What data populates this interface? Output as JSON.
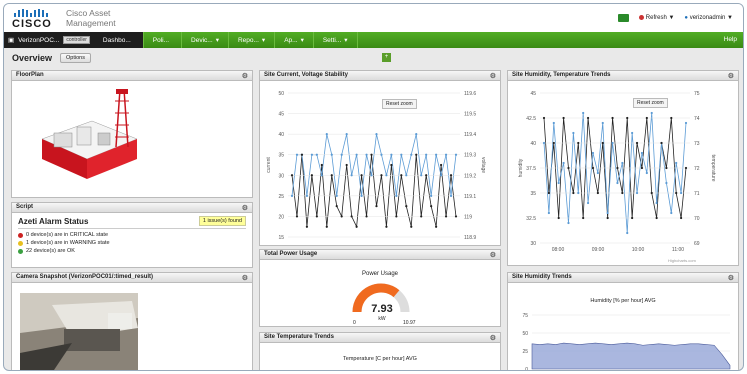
{
  "brand": {
    "name": "CISCO",
    "product_line1": "Cisco Asset",
    "product_line2": "Management"
  },
  "header": {
    "refresh": "Refresh ▼",
    "user": "verizonadmin ▼"
  },
  "nav": {
    "site": "VerizonPOC...",
    "controller": "controller",
    "items": [
      {
        "label": "Dashbo...",
        "arrow": ""
      },
      {
        "label": "Poli...",
        "arrow": ""
      },
      {
        "label": "Devic...",
        "arrow": "▾"
      },
      {
        "label": "Repo...",
        "arrow": "▾"
      },
      {
        "label": "Ap...",
        "arrow": "▾"
      },
      {
        "label": "Setti...",
        "arrow": "▾"
      }
    ],
    "help": "Help"
  },
  "overview": {
    "title": "Overview",
    "options": "Options",
    "add": "+"
  },
  "panels": {
    "floorplan": "FloorPlan",
    "script": "Script",
    "camera": "Camera Snapshot (VerizonPOC01/:timed_result)",
    "current": "Site Current, Voltage Stability",
    "power": "Total Power Usage",
    "temperature": "Site Temperature Trends",
    "humtemp": "Site Humidity, Temperature Trends",
    "humidity": "Site Humidity Trends"
  },
  "alarm": {
    "title": "Azeti Alarm Status",
    "issues": "1 issue(s) found",
    "lines": [
      {
        "color": "#cc2222",
        "text": "0 device(s) are in CRITICAL state"
      },
      {
        "color": "#e8c020",
        "text": "1 device(s) are in WARNING state"
      },
      {
        "color": "#3aa040",
        "text": "22 device(s) are OK"
      }
    ]
  },
  "power_gauge": {
    "title": "Power Usage",
    "value": "7.93",
    "unit": "kW",
    "min": "0",
    "max": "10.97",
    "fraction": 0.723
  },
  "temp_chart": {
    "title": "Temperature [C per hour] AVG"
  },
  "reset_zoom": "Reset zoom",
  "credit": "Highcharts.com",
  "chart_data": [
    {
      "type": "line",
      "title": "Site Current, Voltage Stability",
      "ylabel": "current",
      "y2label": "voltage",
      "ylim": [
        15,
        50
      ],
      "y2lim": [
        118.9,
        119.6
      ],
      "yticks": [
        "50",
        "45",
        "40",
        "35",
        "30",
        "25",
        "20",
        "15"
      ],
      "y2ticks": [
        "119.6",
        "119.5",
        "119.4",
        "119.3",
        "119.2",
        "119.1",
        "119",
        "118.9"
      ],
      "series": [
        {
          "name": "current",
          "color": "#5b9bd5",
          "values": [
            25,
            35,
            35,
            25,
            35,
            35,
            30,
            40,
            35,
            25,
            35,
            40,
            30,
            35,
            25,
            35,
            30,
            40,
            35,
            30,
            35,
            25,
            35,
            30,
            35,
            40,
            30,
            35,
            25,
            35,
            30,
            35,
            25,
            35
          ]
        },
        {
          "name": "voltage",
          "color": "#222222",
          "values": [
            119.2,
            119.0,
            119.3,
            118.95,
            119.2,
            119.0,
            119.25,
            118.95,
            119.2,
            119.05,
            119.0,
            119.25,
            119.0,
            118.95,
            119.2,
            119.0,
            119.3,
            119.05,
            119.2,
            118.95,
            119.25,
            119.0,
            119.2,
            119.05,
            118.95,
            119.3,
            119.0,
            119.2,
            119.05,
            118.95,
            119.25,
            119.0,
            119.2,
            119.0
          ]
        }
      ]
    },
    {
      "type": "line",
      "title": "Site Humidity, Temperature Trends",
      "ylabel": "humidity",
      "y2label": "temperature",
      "ylim": [
        30,
        45
      ],
      "y2lim": [
        69,
        75
      ],
      "yticks": [
        "45",
        "42.5",
        "40",
        "37.5",
        "35",
        "32.5",
        "30"
      ],
      "y2ticks": [
        "75",
        "74",
        "73",
        "72",
        "71",
        "70",
        "69"
      ],
      "xticks": [
        "08:00",
        "09:00",
        "10:00",
        "11:00"
      ],
      "series": [
        {
          "name": "humidity",
          "color": "#5b9bd5",
          "values": [
            40,
            33,
            42,
            36,
            38,
            32,
            41,
            35,
            43,
            34,
            39,
            37,
            42,
            33,
            40,
            36,
            38,
            31,
            41,
            35,
            39,
            37,
            43,
            34,
            40,
            36,
            33,
            38,
            35,
            42
          ]
        },
        {
          "name": "temperature",
          "color": "#222222",
          "values": [
            74,
            71,
            73,
            70,
            74,
            72,
            71,
            73,
            70,
            74,
            72,
            71,
            73,
            70,
            74,
            72,
            71,
            74,
            70,
            73,
            72,
            74,
            71,
            70,
            73,
            72,
            74,
            71,
            70,
            72
          ]
        }
      ]
    },
    {
      "type": "area",
      "title": "Humidity [% per hour] AVG",
      "ylim": [
        0,
        75
      ],
      "yticks": [
        "75",
        "50",
        "25",
        "0"
      ],
      "series": [
        {
          "name": "Humidity [% per hour] AVG",
          "color": "#8e9fd4",
          "values": [
            35,
            34,
            35,
            34,
            36,
            35,
            34,
            35,
            36,
            35,
            34,
            35,
            36,
            35,
            33,
            34,
            35,
            34,
            33,
            34,
            35,
            35,
            34,
            33,
            20,
            5
          ]
        }
      ]
    }
  ]
}
